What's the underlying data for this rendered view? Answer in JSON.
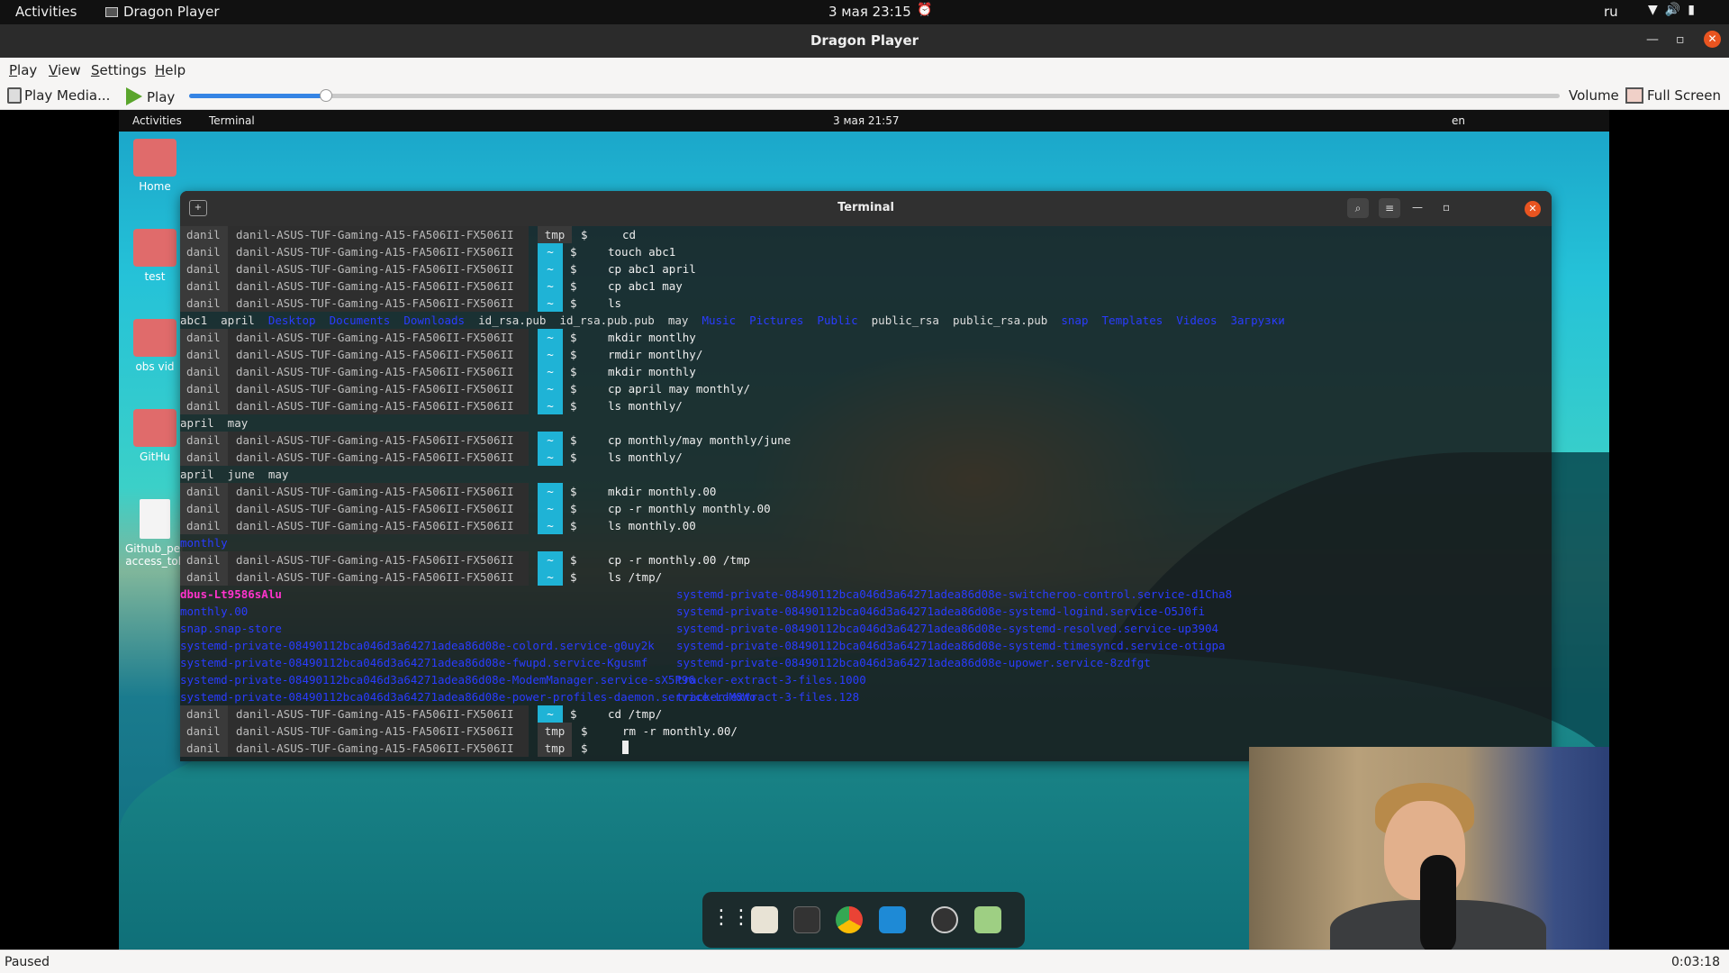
{
  "system_bar": {
    "activities": "Activities",
    "app_name": "Dragon Player",
    "clock": "3 мая  23:15",
    "language": "ru"
  },
  "window": {
    "title": "Dragon Player"
  },
  "menu": {
    "items": [
      "Play",
      "View",
      "Settings",
      "Help"
    ]
  },
  "toolbar": {
    "play_media": "Play Media...",
    "play": "Play",
    "volume": "Volume",
    "full_screen": "Full Screen",
    "seek_progress": 0.1
  },
  "video": {
    "inner_bar": {
      "activities": "Activities",
      "app": "Terminal",
      "clock": "3 мая  21:57",
      "language": "en"
    },
    "desktop_icons": [
      {
        "label": "Home",
        "kind": "home"
      },
      {
        "label": "test",
        "kind": "folder"
      },
      {
        "label": "obs vid",
        "kind": "folder"
      },
      {
        "label": "GitHu",
        "kind": "folder"
      },
      {
        "label": "Github_per\naccess_tok",
        "kind": "doc"
      }
    ],
    "terminal": {
      "title": "Terminal",
      "user": "danil",
      "host": "danil-ASUS-TUF-Gaming-A15-FA506II-FX506II",
      "lines": [
        {
          "t": "p",
          "dir": "tmp",
          "cmd": "cd"
        },
        {
          "t": "p",
          "dir": "~",
          "cmd": "touch abc1"
        },
        {
          "t": "p",
          "dir": "~",
          "cmd": "cp abc1 april"
        },
        {
          "t": "p",
          "dir": "~",
          "cmd": "cp abc1 may"
        },
        {
          "t": "p",
          "dir": "~",
          "cmd": "ls"
        },
        {
          "t": "o",
          "parts": [
            {
              "text": "abc1  april  ",
              "c": "n"
            },
            {
              "text": "Desktop  Documents  Downloads",
              "c": "d"
            },
            {
              "text": "  id_rsa.pub  id_rsa.pub.pub  may  ",
              "c": "n"
            },
            {
              "text": "Music  Pictures  Public",
              "c": "d"
            },
            {
              "text": "  public_rsa  public_rsa.pub  ",
              "c": "n"
            },
            {
              "text": "snap  Templates  Videos  Загрузки",
              "c": "d"
            }
          ]
        },
        {
          "t": "p",
          "dir": "~",
          "cmd": "mkdir montlhy"
        },
        {
          "t": "p",
          "dir": "~",
          "cmd": "rmdir montlhy/"
        },
        {
          "t": "p",
          "dir": "~",
          "cmd": "mkdir monthly"
        },
        {
          "t": "p",
          "dir": "~",
          "cmd": "cp april may monthly/"
        },
        {
          "t": "p",
          "dir": "~",
          "cmd": "ls monthly/"
        },
        {
          "t": "o",
          "parts": [
            {
              "text": "april  may",
              "c": "n"
            }
          ]
        },
        {
          "t": "p",
          "dir": "~",
          "cmd": "cp monthly/may monthly/june"
        },
        {
          "t": "p",
          "dir": "~",
          "cmd": "ls monthly/"
        },
        {
          "t": "o",
          "parts": [
            {
              "text": "april  june  may",
              "c": "n"
            }
          ]
        },
        {
          "t": "p",
          "dir": "~",
          "cmd": "mkdir monthly.00"
        },
        {
          "t": "p",
          "dir": "~",
          "cmd": "cp -r monthly monthly.00"
        },
        {
          "t": "p",
          "dir": "~",
          "cmd": "ls monthly.00"
        },
        {
          "t": "o",
          "parts": [
            {
              "text": "monthly",
              "c": "d"
            }
          ]
        },
        {
          "t": "p",
          "dir": "~",
          "cmd": "cp -r monthly.00 /tmp"
        },
        {
          "t": "p",
          "dir": "~",
          "cmd": "ls /tmp/"
        },
        {
          "t": "o2",
          "left": {
            "text": "dbus-Lt9586sAlu",
            "c": "p"
          },
          "right": {
            "text": "systemd-private-08490112bca046d3a64271adea86d08e-switcheroo-control.service-d1Cha8",
            "c": "d"
          }
        },
        {
          "t": "o2",
          "left": {
            "text": "monthly.00",
            "c": "d"
          },
          "right": {
            "text": "systemd-private-08490112bca046d3a64271adea86d08e-systemd-logind.service-O5J0fi",
            "c": "d"
          }
        },
        {
          "t": "o2",
          "left": {
            "text": "snap.snap-store",
            "c": "d"
          },
          "right": {
            "text": "systemd-private-08490112bca046d3a64271adea86d08e-systemd-resolved.service-up3904",
            "c": "d"
          }
        },
        {
          "t": "o2",
          "left": {
            "text": "systemd-private-08490112bca046d3a64271adea86d08e-colord.service-g0uy2k",
            "c": "d"
          },
          "right": {
            "text": "systemd-private-08490112bca046d3a64271adea86d08e-systemd-timesyncd.service-otigpa",
            "c": "d"
          }
        },
        {
          "t": "o2",
          "left": {
            "text": "systemd-private-08490112bca046d3a64271adea86d08e-fwupd.service-Kgusmf",
            "c": "d"
          },
          "right": {
            "text": "systemd-private-08490112bca046d3a64271adea86d08e-upower.service-8zdfgt",
            "c": "d"
          }
        },
        {
          "t": "o2",
          "left": {
            "text": "systemd-private-08490112bca046d3a64271adea86d08e-ModemManager.service-sX5P96",
            "c": "d"
          },
          "right": {
            "text": "tracker-extract-3-files.1000",
            "c": "d"
          }
        },
        {
          "t": "o2",
          "left": {
            "text": "systemd-private-08490112bca046d3a64271adea86d08e-power-profiles-daemon.service-LdM8Wo",
            "c": "d"
          },
          "right": {
            "text": "tracker-extract-3-files.128",
            "c": "d"
          }
        },
        {
          "t": "p",
          "dir": "~",
          "cmd": "cd /tmp/"
        },
        {
          "t": "p",
          "dir": "tmp",
          "cmd": "rm -r monthly.00/"
        },
        {
          "t": "p",
          "dir": "tmp",
          "cmd": "",
          "cursor": true
        }
      ]
    }
  },
  "status": {
    "state": "Paused",
    "time": "0:03:18"
  },
  "colors": {
    "accent": "#3584e4",
    "close": "#e95420",
    "prompt_dir": "#1fb3d6",
    "dir_text": "#2a3cff",
    "special_text": "#ff33cc"
  }
}
